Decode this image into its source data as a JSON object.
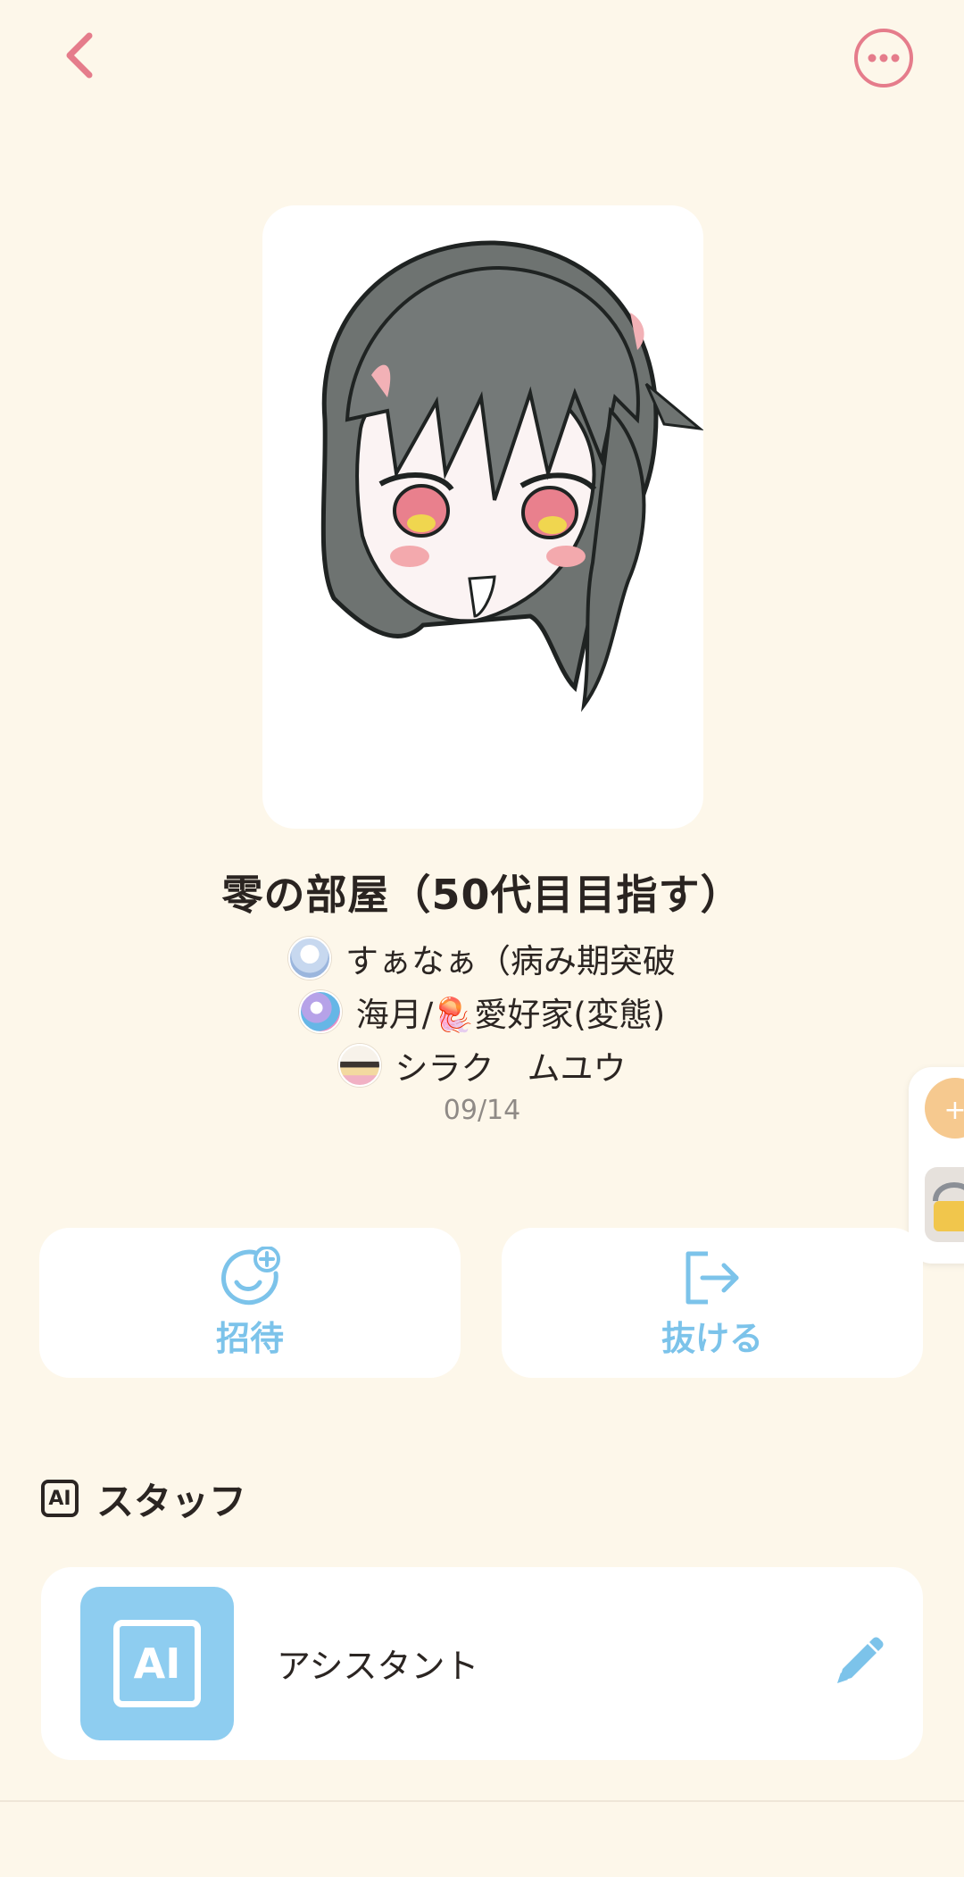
{
  "header": {
    "back_icon": "chevron-left-icon",
    "more_icon": "more-horizontal-icon",
    "accent_color": "#e57c8b"
  },
  "room": {
    "title": "零の部屋（50代目目指す）",
    "members": [
      {
        "name": "すぁなぁ（病み期突破"
      },
      {
        "name": "海月/🪼愛好家(変態)"
      },
      {
        "name": "シラク　ムユウ"
      }
    ],
    "date": "09/14"
  },
  "actions": {
    "invite_label": "招待",
    "invite_icon": "smile-plus-icon",
    "leave_label": "抜ける",
    "leave_icon": "exit-icon",
    "accent_color": "#7cc3ea"
  },
  "staff": {
    "section_icon": "ai-badge-icon",
    "section_icon_text": "AI",
    "section_title": "スタッフ",
    "items": [
      {
        "name": "アシスタント",
        "avatar_text": "AI",
        "edit_icon": "pencil-icon"
      }
    ]
  }
}
